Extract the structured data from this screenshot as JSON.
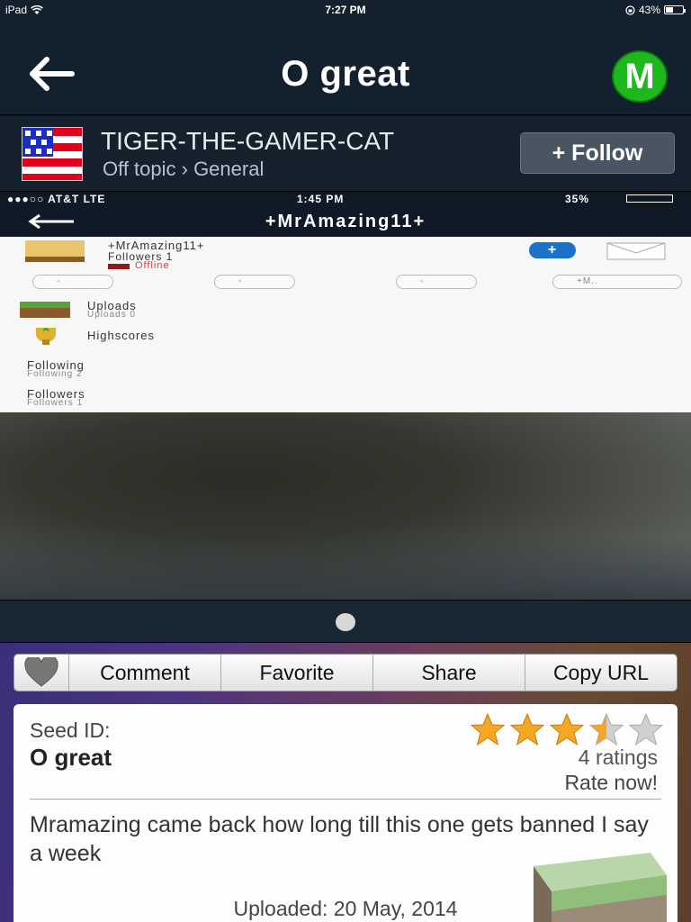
{
  "status_bar": {
    "device": "iPad",
    "time": "7:27 PM",
    "battery": "43%",
    "battery_level": 0.43
  },
  "nav": {
    "title": "O great",
    "avatar_letter": "M"
  },
  "author": {
    "name": "TIGER-THE-GAMER-CAT",
    "breadcrumb": "Off topic › General",
    "follow_label": "+ Follow"
  },
  "screenshot": {
    "status": {
      "carrier": "●●●○○ AT&T  LTE",
      "time": "1:45 PM",
      "battery": "35%"
    },
    "nav_title": "+MrAmazing11+",
    "profile_name": "+MrAmazing11+",
    "followers_line": "Followers 1",
    "status_text": "Offline",
    "pill_labels": [
      "-",
      "-",
      "-",
      "+M.."
    ],
    "uploads": "Uploads",
    "uploads_sub": "Uploads 0",
    "highscores": "Highscores",
    "following": "Following",
    "following_sub": "Following 2",
    "followers": "Followers",
    "followers_sub": "Followers 1"
  },
  "actions": {
    "comment": "Comment",
    "favorite": "Favorite",
    "share": "Share",
    "copy_url": "Copy URL"
  },
  "seed": {
    "label": "Seed ID:",
    "name": "O great",
    "rating_stars": 3.5,
    "ratings_count": "4 ratings",
    "rate_now": "Rate now!",
    "description": "Mramazing came back how long till this one gets banned I say a week",
    "uploaded": "Uploaded: 20 May, 2014"
  },
  "colors": {
    "accent_green": "#1eb81e",
    "nav_bg": "#13202e",
    "star": "#f5a623"
  }
}
